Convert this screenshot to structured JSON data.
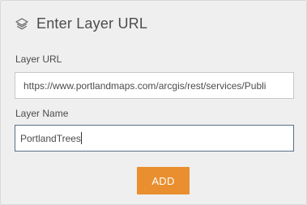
{
  "header": {
    "icon": "layers-icon",
    "title": "Enter Layer URL"
  },
  "layer_url": {
    "label": "Layer URL",
    "value": "https://www.portlandmaps.com/arcgis/rest/services/Publi"
  },
  "layer_name": {
    "label": "Layer Name",
    "value": "PortlandTrees"
  },
  "actions": {
    "add_label": "ADD"
  },
  "colors": {
    "panel_bg": "#efefef",
    "button_bg": "#e98f2f",
    "focus_border": "#5a6f86"
  }
}
